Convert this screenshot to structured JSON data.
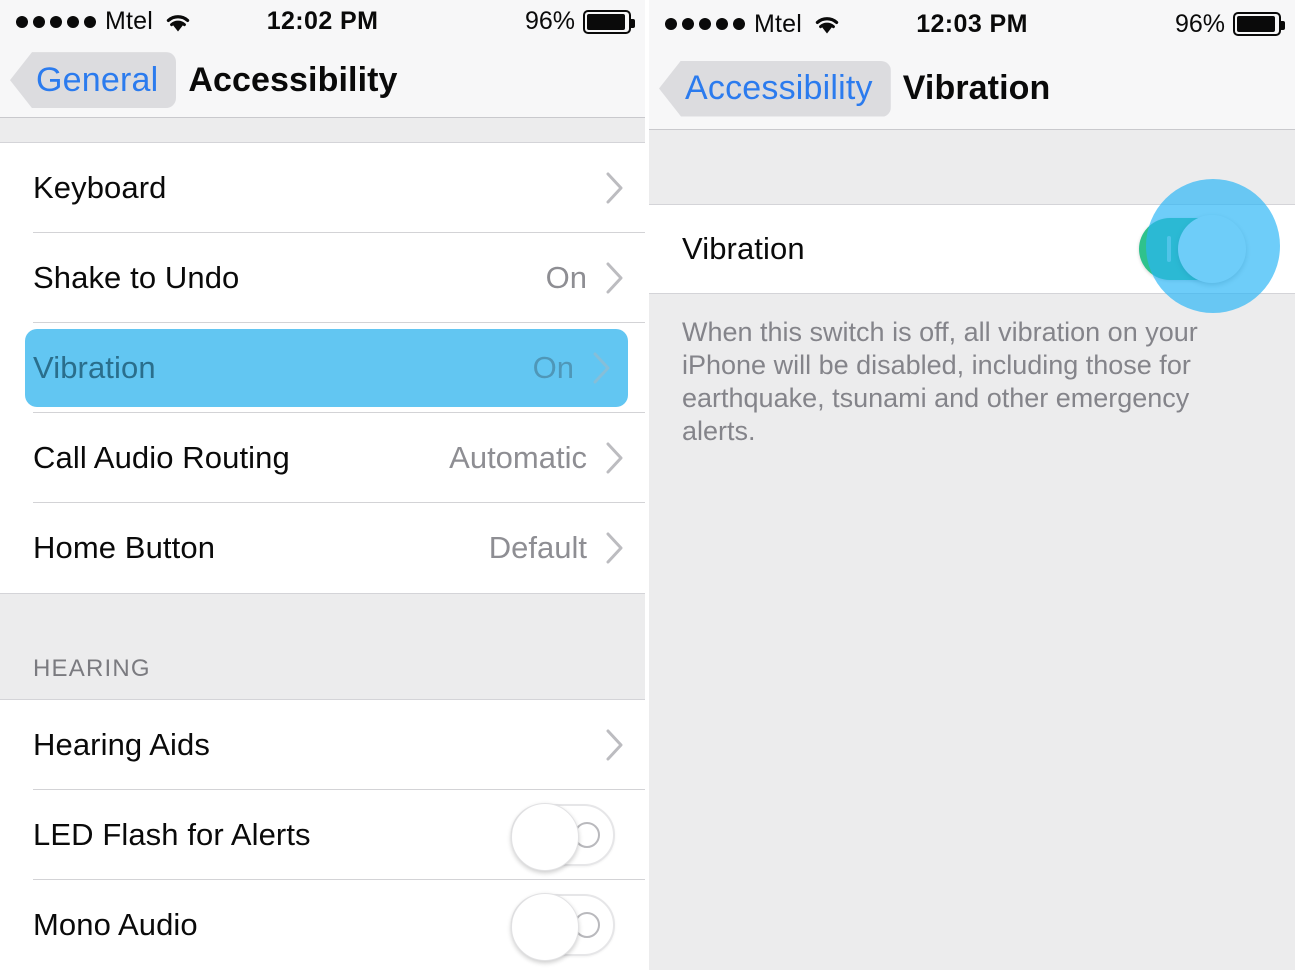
{
  "left_screen": {
    "status_bar": {
      "signal_dots": 5,
      "carrier": "Mtel",
      "wifi_icon": "wifi-icon",
      "time": "12:02 PM",
      "battery_percent": "96%",
      "battery_icon": "battery-full-icon"
    },
    "nav": {
      "back_label": "General",
      "title": "Accessibility",
      "back_icon": "back-chevron-icon"
    },
    "sections": [
      {
        "header": "",
        "rows": [
          {
            "title": "Keyboard",
            "value": "",
            "accessory": "chevron",
            "highlight": false
          },
          {
            "title": "Shake to Undo",
            "value": "On",
            "accessory": "chevron",
            "highlight": false
          },
          {
            "title": "Vibration",
            "value": "On",
            "accessory": "chevron",
            "highlight": true
          },
          {
            "title": "Call Audio Routing",
            "value": "Automatic",
            "accessory": "chevron",
            "highlight": false
          },
          {
            "title": "Home Button",
            "value": "Default",
            "accessory": "chevron",
            "highlight": false
          }
        ]
      },
      {
        "header": "HEARING",
        "rows": [
          {
            "title": "Hearing Aids",
            "value": "",
            "accessory": "chevron",
            "highlight": false
          },
          {
            "title": "LED Flash for Alerts",
            "value": "",
            "accessory": "toggle-off",
            "highlight": false
          },
          {
            "title": "Mono Audio",
            "value": "",
            "accessory": "toggle-off",
            "highlight": false
          }
        ]
      }
    ]
  },
  "right_screen": {
    "status_bar": {
      "signal_dots": 5,
      "carrier": "Mtel",
      "wifi_icon": "wifi-icon",
      "time": "12:03 PM",
      "battery_percent": "96%",
      "battery_icon": "battery-full-icon"
    },
    "nav": {
      "back_label": "Accessibility",
      "title": "Vibration",
      "back_icon": "back-chevron-icon"
    },
    "row": {
      "title": "Vibration",
      "toggle_state": "on",
      "toggle_icon": "toggle-switch-on-icon"
    },
    "footnote": "When this switch is off, all vibration on your iPhone will be disabled, including those for earthquake, tsunami and other emergency alerts."
  },
  "colors": {
    "accent_blue": "#2b7bee",
    "highlight_blue": "#62c6f2",
    "toggle_green": "#2fc28c",
    "group_gray": "#ececed",
    "value_gray": "#8e8e93"
  }
}
